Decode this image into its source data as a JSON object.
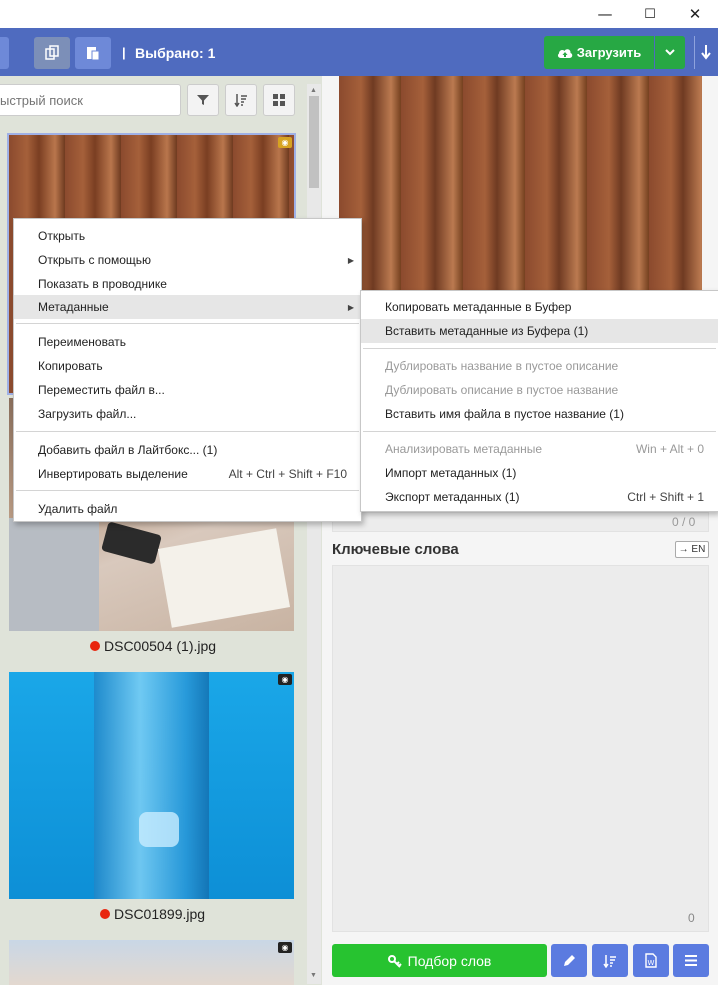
{
  "window": {
    "minimize": "—",
    "maximize": "☐",
    "close": "✕"
  },
  "toolbar": {
    "selected_label": "Выбрано: 1",
    "upload_label": "Загрузить"
  },
  "search": {
    "placeholder": "ыстрый поиск"
  },
  "thumbnails": [
    {
      "filename": "DSC00504 (1).jpg"
    },
    {
      "filename": "DSC01899.jpg"
    }
  ],
  "context_menu": {
    "items": [
      {
        "label": "Открыть"
      },
      {
        "label": "Открыть с помощью"
      },
      {
        "label": "Показать в проводнике"
      },
      {
        "label": "Метаданные"
      },
      {
        "label": "Переименовать"
      },
      {
        "label": "Копировать"
      },
      {
        "label": "Переместить файл в..."
      },
      {
        "label": "Загрузить файл..."
      },
      {
        "label": "Добавить файл в Лайтбокс... (1)"
      },
      {
        "label": "Инвертировать выделение",
        "shortcut": "Alt + Ctrl + Shift + F10"
      },
      {
        "label": "Удалить файл"
      }
    ]
  },
  "submenu": {
    "items": [
      {
        "label": "Копировать метаданные в Буфер"
      },
      {
        "label": "Вставить метаданные из Буфера (1)"
      },
      {
        "label": "Дублировать название в пустое описание"
      },
      {
        "label": "Дублировать описание в пустое название"
      },
      {
        "label": "Вставить имя файла в пустое название (1)"
      },
      {
        "label": "Анализировать метаданные",
        "shortcut": "Win + Alt + 0"
      },
      {
        "label": "Импорт метаданных (1)"
      },
      {
        "label": "Экспорт метаданных (1)",
        "shortcut": "Ctrl + Shift + 1"
      }
    ]
  },
  "description": {
    "counter": "0 / 0"
  },
  "keywords": {
    "title": "Ключевые слова",
    "lang_button": "→ EN",
    "count": "0"
  },
  "bottom": {
    "suggest_label": "Подбор слов"
  }
}
